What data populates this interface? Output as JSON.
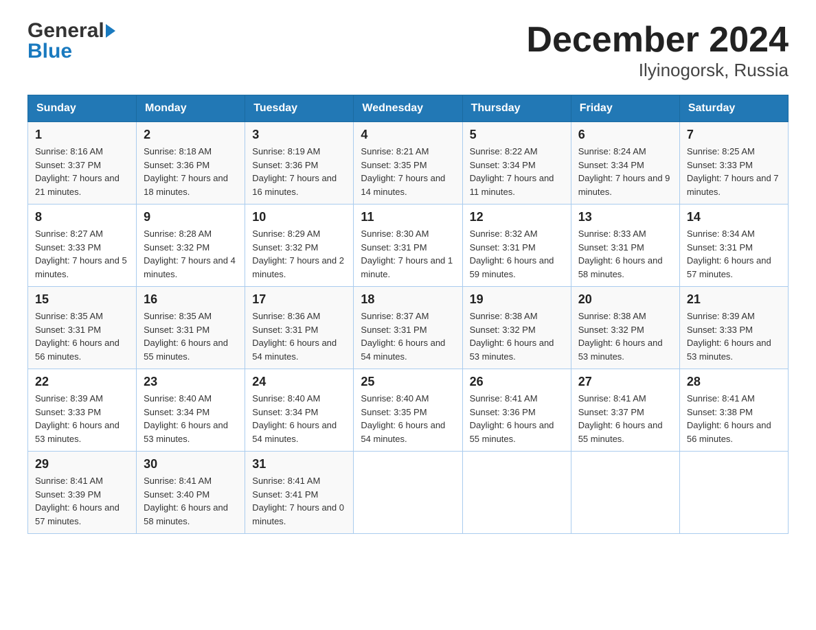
{
  "header": {
    "logo_general": "General",
    "logo_blue": "Blue",
    "title": "December 2024",
    "subtitle": "Ilyinogorsk, Russia"
  },
  "days_of_week": [
    "Sunday",
    "Monday",
    "Tuesday",
    "Wednesday",
    "Thursday",
    "Friday",
    "Saturday"
  ],
  "weeks": [
    [
      {
        "day": "1",
        "sunrise": "Sunrise: 8:16 AM",
        "sunset": "Sunset: 3:37 PM",
        "daylight": "Daylight: 7 hours and 21 minutes."
      },
      {
        "day": "2",
        "sunrise": "Sunrise: 8:18 AM",
        "sunset": "Sunset: 3:36 PM",
        "daylight": "Daylight: 7 hours and 18 minutes."
      },
      {
        "day": "3",
        "sunrise": "Sunrise: 8:19 AM",
        "sunset": "Sunset: 3:36 PM",
        "daylight": "Daylight: 7 hours and 16 minutes."
      },
      {
        "day": "4",
        "sunrise": "Sunrise: 8:21 AM",
        "sunset": "Sunset: 3:35 PM",
        "daylight": "Daylight: 7 hours and 14 minutes."
      },
      {
        "day": "5",
        "sunrise": "Sunrise: 8:22 AM",
        "sunset": "Sunset: 3:34 PM",
        "daylight": "Daylight: 7 hours and 11 minutes."
      },
      {
        "day": "6",
        "sunrise": "Sunrise: 8:24 AM",
        "sunset": "Sunset: 3:34 PM",
        "daylight": "Daylight: 7 hours and 9 minutes."
      },
      {
        "day": "7",
        "sunrise": "Sunrise: 8:25 AM",
        "sunset": "Sunset: 3:33 PM",
        "daylight": "Daylight: 7 hours and 7 minutes."
      }
    ],
    [
      {
        "day": "8",
        "sunrise": "Sunrise: 8:27 AM",
        "sunset": "Sunset: 3:33 PM",
        "daylight": "Daylight: 7 hours and 5 minutes."
      },
      {
        "day": "9",
        "sunrise": "Sunrise: 8:28 AM",
        "sunset": "Sunset: 3:32 PM",
        "daylight": "Daylight: 7 hours and 4 minutes."
      },
      {
        "day": "10",
        "sunrise": "Sunrise: 8:29 AM",
        "sunset": "Sunset: 3:32 PM",
        "daylight": "Daylight: 7 hours and 2 minutes."
      },
      {
        "day": "11",
        "sunrise": "Sunrise: 8:30 AM",
        "sunset": "Sunset: 3:31 PM",
        "daylight": "Daylight: 7 hours and 1 minute."
      },
      {
        "day": "12",
        "sunrise": "Sunrise: 8:32 AM",
        "sunset": "Sunset: 3:31 PM",
        "daylight": "Daylight: 6 hours and 59 minutes."
      },
      {
        "day": "13",
        "sunrise": "Sunrise: 8:33 AM",
        "sunset": "Sunset: 3:31 PM",
        "daylight": "Daylight: 6 hours and 58 minutes."
      },
      {
        "day": "14",
        "sunrise": "Sunrise: 8:34 AM",
        "sunset": "Sunset: 3:31 PM",
        "daylight": "Daylight: 6 hours and 57 minutes."
      }
    ],
    [
      {
        "day": "15",
        "sunrise": "Sunrise: 8:35 AM",
        "sunset": "Sunset: 3:31 PM",
        "daylight": "Daylight: 6 hours and 56 minutes."
      },
      {
        "day": "16",
        "sunrise": "Sunrise: 8:35 AM",
        "sunset": "Sunset: 3:31 PM",
        "daylight": "Daylight: 6 hours and 55 minutes."
      },
      {
        "day": "17",
        "sunrise": "Sunrise: 8:36 AM",
        "sunset": "Sunset: 3:31 PM",
        "daylight": "Daylight: 6 hours and 54 minutes."
      },
      {
        "day": "18",
        "sunrise": "Sunrise: 8:37 AM",
        "sunset": "Sunset: 3:31 PM",
        "daylight": "Daylight: 6 hours and 54 minutes."
      },
      {
        "day": "19",
        "sunrise": "Sunrise: 8:38 AM",
        "sunset": "Sunset: 3:32 PM",
        "daylight": "Daylight: 6 hours and 53 minutes."
      },
      {
        "day": "20",
        "sunrise": "Sunrise: 8:38 AM",
        "sunset": "Sunset: 3:32 PM",
        "daylight": "Daylight: 6 hours and 53 minutes."
      },
      {
        "day": "21",
        "sunrise": "Sunrise: 8:39 AM",
        "sunset": "Sunset: 3:33 PM",
        "daylight": "Daylight: 6 hours and 53 minutes."
      }
    ],
    [
      {
        "day": "22",
        "sunrise": "Sunrise: 8:39 AM",
        "sunset": "Sunset: 3:33 PM",
        "daylight": "Daylight: 6 hours and 53 minutes."
      },
      {
        "day": "23",
        "sunrise": "Sunrise: 8:40 AM",
        "sunset": "Sunset: 3:34 PM",
        "daylight": "Daylight: 6 hours and 53 minutes."
      },
      {
        "day": "24",
        "sunrise": "Sunrise: 8:40 AM",
        "sunset": "Sunset: 3:34 PM",
        "daylight": "Daylight: 6 hours and 54 minutes."
      },
      {
        "day": "25",
        "sunrise": "Sunrise: 8:40 AM",
        "sunset": "Sunset: 3:35 PM",
        "daylight": "Daylight: 6 hours and 54 minutes."
      },
      {
        "day": "26",
        "sunrise": "Sunrise: 8:41 AM",
        "sunset": "Sunset: 3:36 PM",
        "daylight": "Daylight: 6 hours and 55 minutes."
      },
      {
        "day": "27",
        "sunrise": "Sunrise: 8:41 AM",
        "sunset": "Sunset: 3:37 PM",
        "daylight": "Daylight: 6 hours and 55 minutes."
      },
      {
        "day": "28",
        "sunrise": "Sunrise: 8:41 AM",
        "sunset": "Sunset: 3:38 PM",
        "daylight": "Daylight: 6 hours and 56 minutes."
      }
    ],
    [
      {
        "day": "29",
        "sunrise": "Sunrise: 8:41 AM",
        "sunset": "Sunset: 3:39 PM",
        "daylight": "Daylight: 6 hours and 57 minutes."
      },
      {
        "day": "30",
        "sunrise": "Sunrise: 8:41 AM",
        "sunset": "Sunset: 3:40 PM",
        "daylight": "Daylight: 6 hours and 58 minutes."
      },
      {
        "day": "31",
        "sunrise": "Sunrise: 8:41 AM",
        "sunset": "Sunset: 3:41 PM",
        "daylight": "Daylight: 7 hours and 0 minutes."
      },
      null,
      null,
      null,
      null
    ]
  ]
}
